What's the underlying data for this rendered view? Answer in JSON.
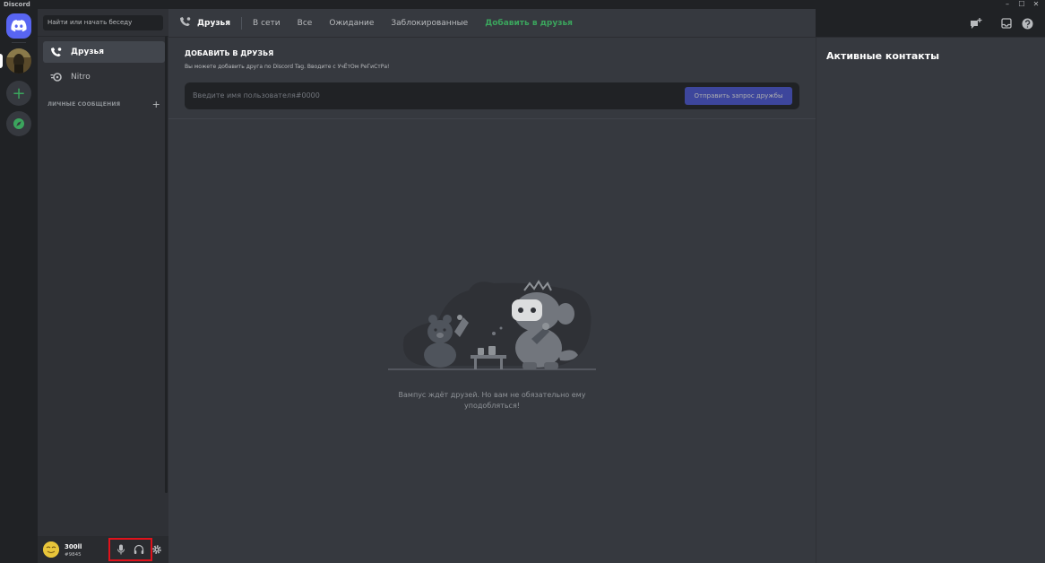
{
  "window": {
    "title": "Discord",
    "controls": {
      "minimize": "–",
      "maximize": "☐",
      "close": "✕"
    }
  },
  "sidebar": {
    "search_placeholder": "Найти или начать беседу",
    "nav": [
      {
        "label": "Друзья"
      },
      {
        "label": "Nitro"
      }
    ],
    "dm_header": "ЛИЧНЫЕ СООБЩЕНИЯ",
    "dm_add": "+"
  },
  "user": {
    "name": "300ll",
    "tag": "#9845"
  },
  "header": {
    "title": "Друзья",
    "tabs": [
      "В сети",
      "Все",
      "Ожидание",
      "Заблокированные"
    ],
    "add_friend_tab": "Добавить в друзья"
  },
  "add_friend": {
    "title": "ДОБАВИТЬ В ДРУЗЬЯ",
    "description": "Вы можете добавить друга по Discord Tag. Вводите с УчЁтОм РеГиСтРа!",
    "placeholder": "Введите имя пользователя#0000",
    "button": "Отправить запрос дружбы"
  },
  "empty_state": {
    "text": "Вампус ждёт друзей. Но вам не обязательно ему уподобляться!"
  },
  "active_contacts": {
    "title": "Активные контакты"
  },
  "colors": {
    "brand": "#5865f2",
    "green": "#3ba55d",
    "highlight_box": "#e0121b"
  }
}
